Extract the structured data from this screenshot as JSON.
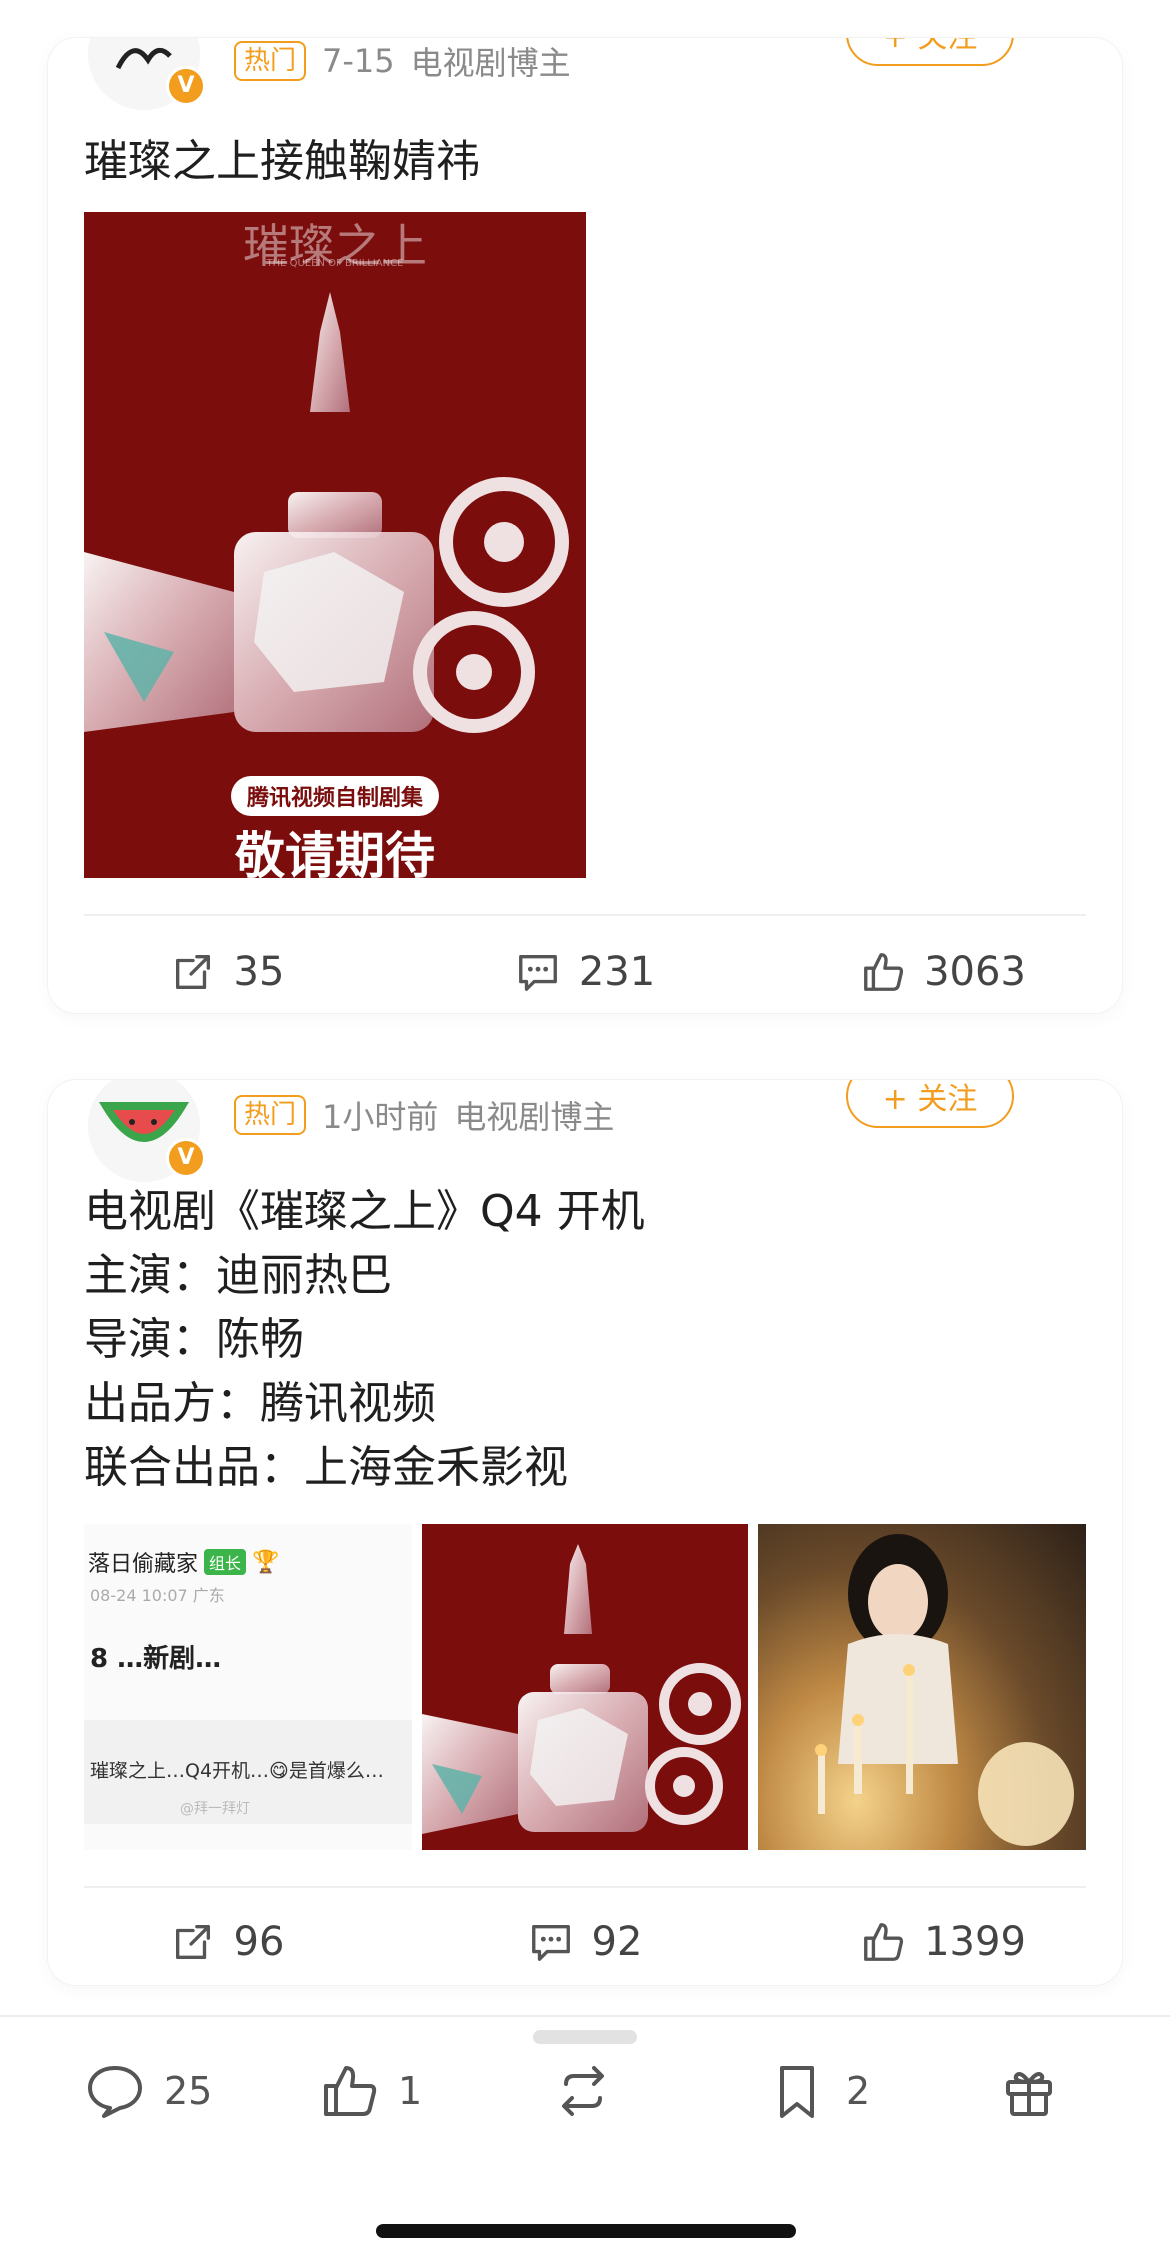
{
  "posts": [
    {
      "hot_label": "热门",
      "time": "7-15",
      "source": "电视剧博主",
      "follow_label": "+ 关注",
      "text_lines": [
        "璀璨之上接触鞠婧祎"
      ],
      "poster": {
        "title": "璀璨之上",
        "subtitle": "THE QUEEN OF BRILLIANCE",
        "chip": "腾讯视频自制剧集",
        "slogan": "敬请期待"
      },
      "actions": {
        "repost": "35",
        "comment": "231",
        "like": "3063"
      }
    },
    {
      "hot_label": "热门",
      "time": "1小时前",
      "source": "电视剧博主",
      "follow_label": "+ 关注",
      "text_lines": [
        "电视剧《璀璨之上》Q4 开机",
        "主演：迪丽热巴",
        "导演：陈畅",
        "出品方：腾讯视频",
        "联合出品：上海金禾影视"
      ],
      "screenshot": {
        "user": "落日偷藏家",
        "tag": "组长",
        "date": "08-24 10:07 广东",
        "headline": "8 …新剧…",
        "snippet": "璀璨之上…Q4开机…😋是首爆么…",
        "watermark": "@拜一拜灯"
      },
      "poster": {
        "chip": "",
        "slogan": ""
      },
      "actions": {
        "repost": "96",
        "comment": "92",
        "like": "1399"
      }
    }
  ],
  "bottom_bar": {
    "comment_count": "25",
    "like_count": "1",
    "bookmark_count": "2"
  },
  "colors": {
    "accent": "#f29d1e",
    "poster_red": "#7b0d0d"
  },
  "icons": [
    "repost-icon",
    "comment-icon",
    "like-icon",
    "bookmark-icon",
    "gift-icon",
    "verified-icon"
  ]
}
